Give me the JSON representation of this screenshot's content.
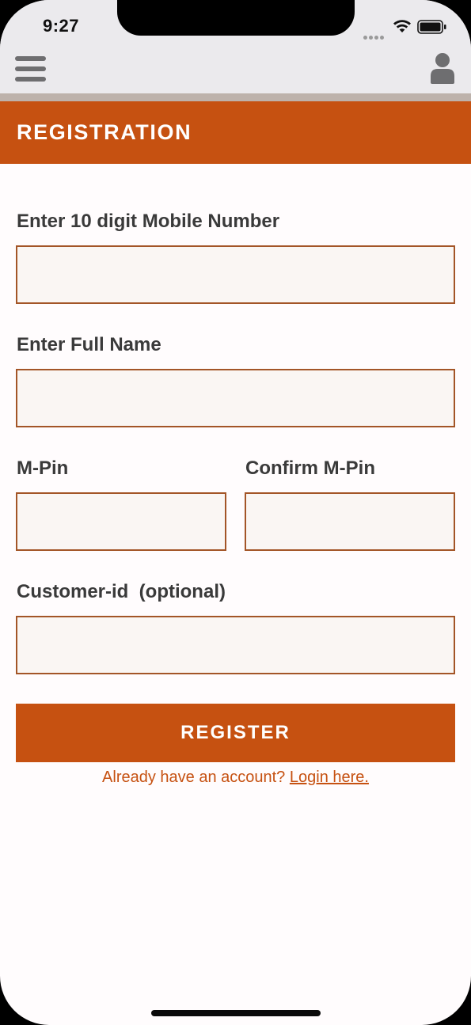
{
  "status_bar": {
    "time": "9:27"
  },
  "nav": {
    "menu_icon": "hamburger-menu-icon",
    "user_icon": "user-profile-icon"
  },
  "header": {
    "title": "REGISTRATION"
  },
  "form": {
    "mobile_label": "Enter 10 digit Mobile Number",
    "mobile_value": "",
    "full_name_label": "Enter Full Name",
    "full_name_value": "",
    "mpin_label": "M-Pin",
    "mpin_value": "",
    "confirm_mpin_label": "Confirm M-Pin",
    "confirm_mpin_value": "",
    "customer_id_label": "Customer-id  (optional)",
    "customer_id_value": "",
    "register_label": "REGISTER",
    "login_prompt": "Already have an account?",
    "login_link": "Login here."
  },
  "colors": {
    "accent": "#c65111",
    "nav_background": "#ebeaed",
    "field_background": "#faf6f3",
    "field_border": "#a35527",
    "label_text": "#3a3a3a"
  }
}
